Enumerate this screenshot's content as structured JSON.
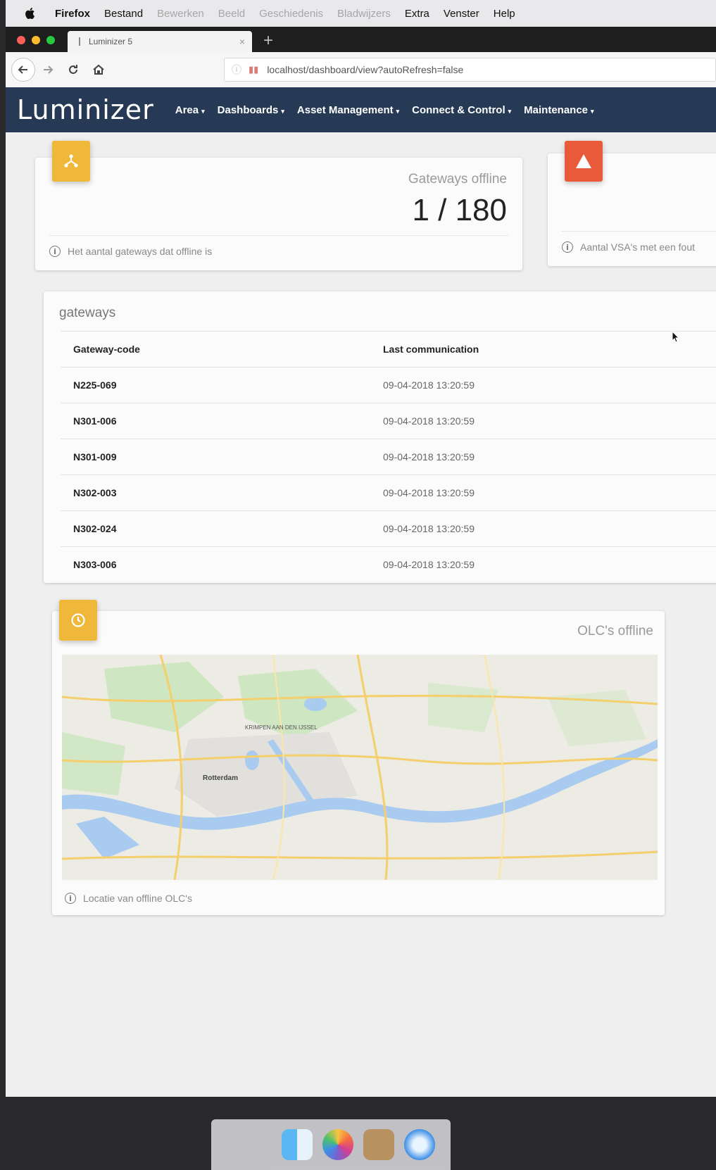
{
  "menubar": {
    "items": [
      "Firefox",
      "Bestand",
      "Bewerken",
      "Beeld",
      "Geschiedenis",
      "Bladwijzers",
      "Extra",
      "Venster",
      "Help"
    ]
  },
  "browser": {
    "tab_title": "Luminizer 5",
    "tab_close": "×",
    "new_tab": "+",
    "url": "localhost/dashboard/view?autoRefresh=false"
  },
  "app": {
    "logo": "Luminizer",
    "nav": [
      "Area",
      "Dashboards",
      "Asset Management",
      "Connect & Control",
      "Maintenance"
    ]
  },
  "gateways_card": {
    "title": "Gateways offline",
    "value": "1 / 180",
    "footer": "Het aantal gateways dat offline is",
    "icon": "gateway-network-icon",
    "icon_color": "#f0b83a"
  },
  "vsa_card": {
    "footer": "Aantal VSA's met een fout",
    "icon": "warning-icon",
    "icon_color": "#e95a3a"
  },
  "gateways_table": {
    "title": "gateways",
    "columns": [
      "Gateway-code",
      "Last communication"
    ],
    "rows": [
      {
        "code": "N225-069",
        "time": "09-04-2018 13:20:59"
      },
      {
        "code": "N301-006",
        "time": "09-04-2018 13:20:59"
      },
      {
        "code": "N301-009",
        "time": "09-04-2018 13:20:59"
      },
      {
        "code": "N302-003",
        "time": "09-04-2018 13:20:59"
      },
      {
        "code": "N302-024",
        "time": "09-04-2018 13:20:59"
      },
      {
        "code": "N303-006",
        "time": "09-04-2018 13:20:59"
      }
    ]
  },
  "olc_card": {
    "title": "OLC's offline",
    "footer": "Locatie van offline OLC's",
    "icon": "clock-icon",
    "icon_color": "#f0b83a",
    "map_labels": [
      "Rotterdam",
      "KRIMPEN AAN DEN IJSSEL"
    ]
  }
}
